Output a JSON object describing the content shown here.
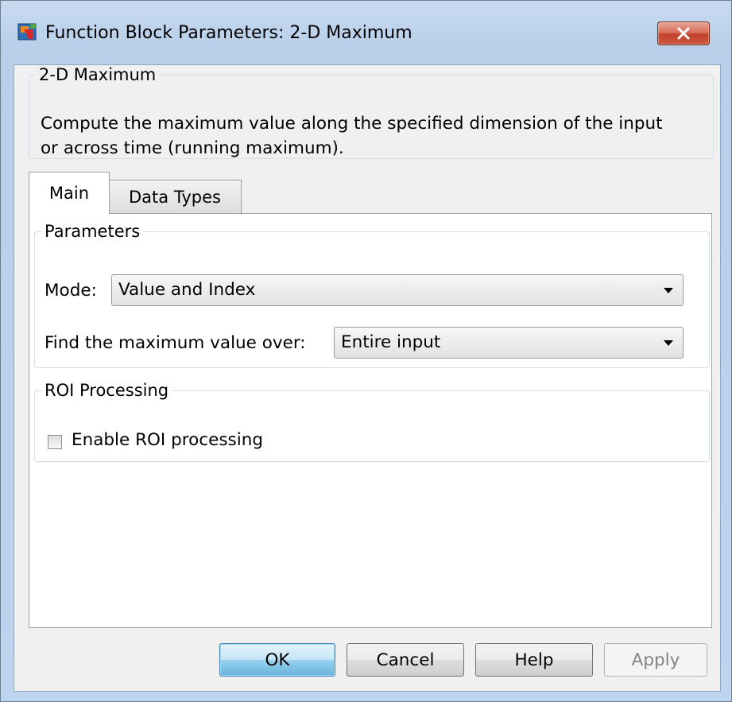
{
  "window": {
    "title": "Function Block Parameters: 2-D Maximum",
    "close_symbol": "×"
  },
  "description": {
    "legend": "2-D Maximum",
    "text_line1": "Compute the maximum value along the specified dimension of the input",
    "text_line2": "or across time (running maximum)."
  },
  "tabs": [
    {
      "label": "Main",
      "active": true
    },
    {
      "label": "Data Types",
      "active": false
    }
  ],
  "parameters": {
    "legend": "Parameters",
    "mode_label": "Mode:",
    "mode_value": "Value and Index",
    "find_label": "Find the maximum value over:",
    "find_value": "Entire input"
  },
  "roi": {
    "legend": "ROI Processing",
    "enable_label": "Enable ROI processing",
    "enabled": false
  },
  "buttons": {
    "ok": "OK",
    "cancel": "Cancel",
    "help": "Help",
    "apply": "Apply"
  },
  "icons": {
    "app": "simulink-block-icon",
    "close": "close-icon",
    "dropdown": "chevron-down-icon"
  },
  "colors": {
    "close_button": "#c2412a",
    "primary_button": "#98d1ef",
    "frame": "#b9cfe9"
  }
}
